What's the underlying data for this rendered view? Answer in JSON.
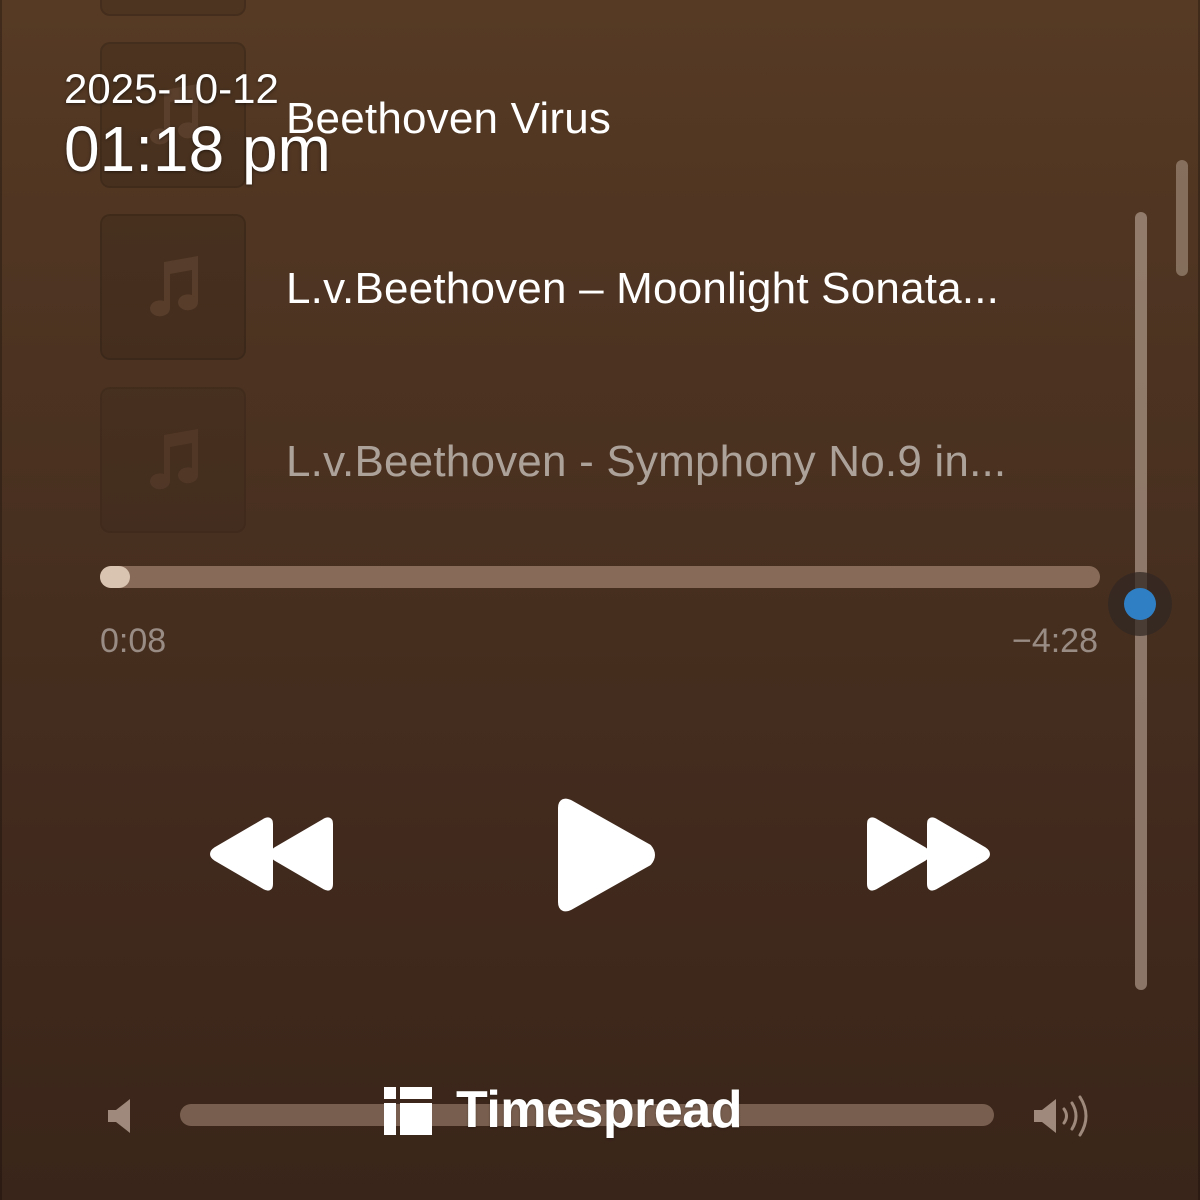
{
  "overlay": {
    "date": "2025-10-12",
    "time": "01:18 pm"
  },
  "queue": {
    "tracks": [
      {
        "title": "Beethoven Virus",
        "artwork_icon": "music-note-icon"
      },
      {
        "title": "L.v.Beethoven – Moonlight Sonata...",
        "artwork_icon": "music-note-icon"
      },
      {
        "title": "L.v.Beethoven - Symphony No.9 in...",
        "artwork_icon": "music-note-icon"
      }
    ]
  },
  "playback": {
    "elapsed": "0:08",
    "remaining": "−4:28",
    "progress_fraction": 0.03
  },
  "controls": {
    "rewind_icon": "rewind-icon",
    "play_icon": "play-icon",
    "fast_forward_icon": "fast-forward-icon"
  },
  "volume": {
    "min_icon": "volume-low-icon",
    "max_icon": "volume-high-icon"
  },
  "watermark": {
    "brand": "Timespread",
    "icon": "timespread-logo-icon"
  },
  "colors": {
    "accent": "#2f7fc4",
    "progress_fill": "#d9c3b1"
  }
}
